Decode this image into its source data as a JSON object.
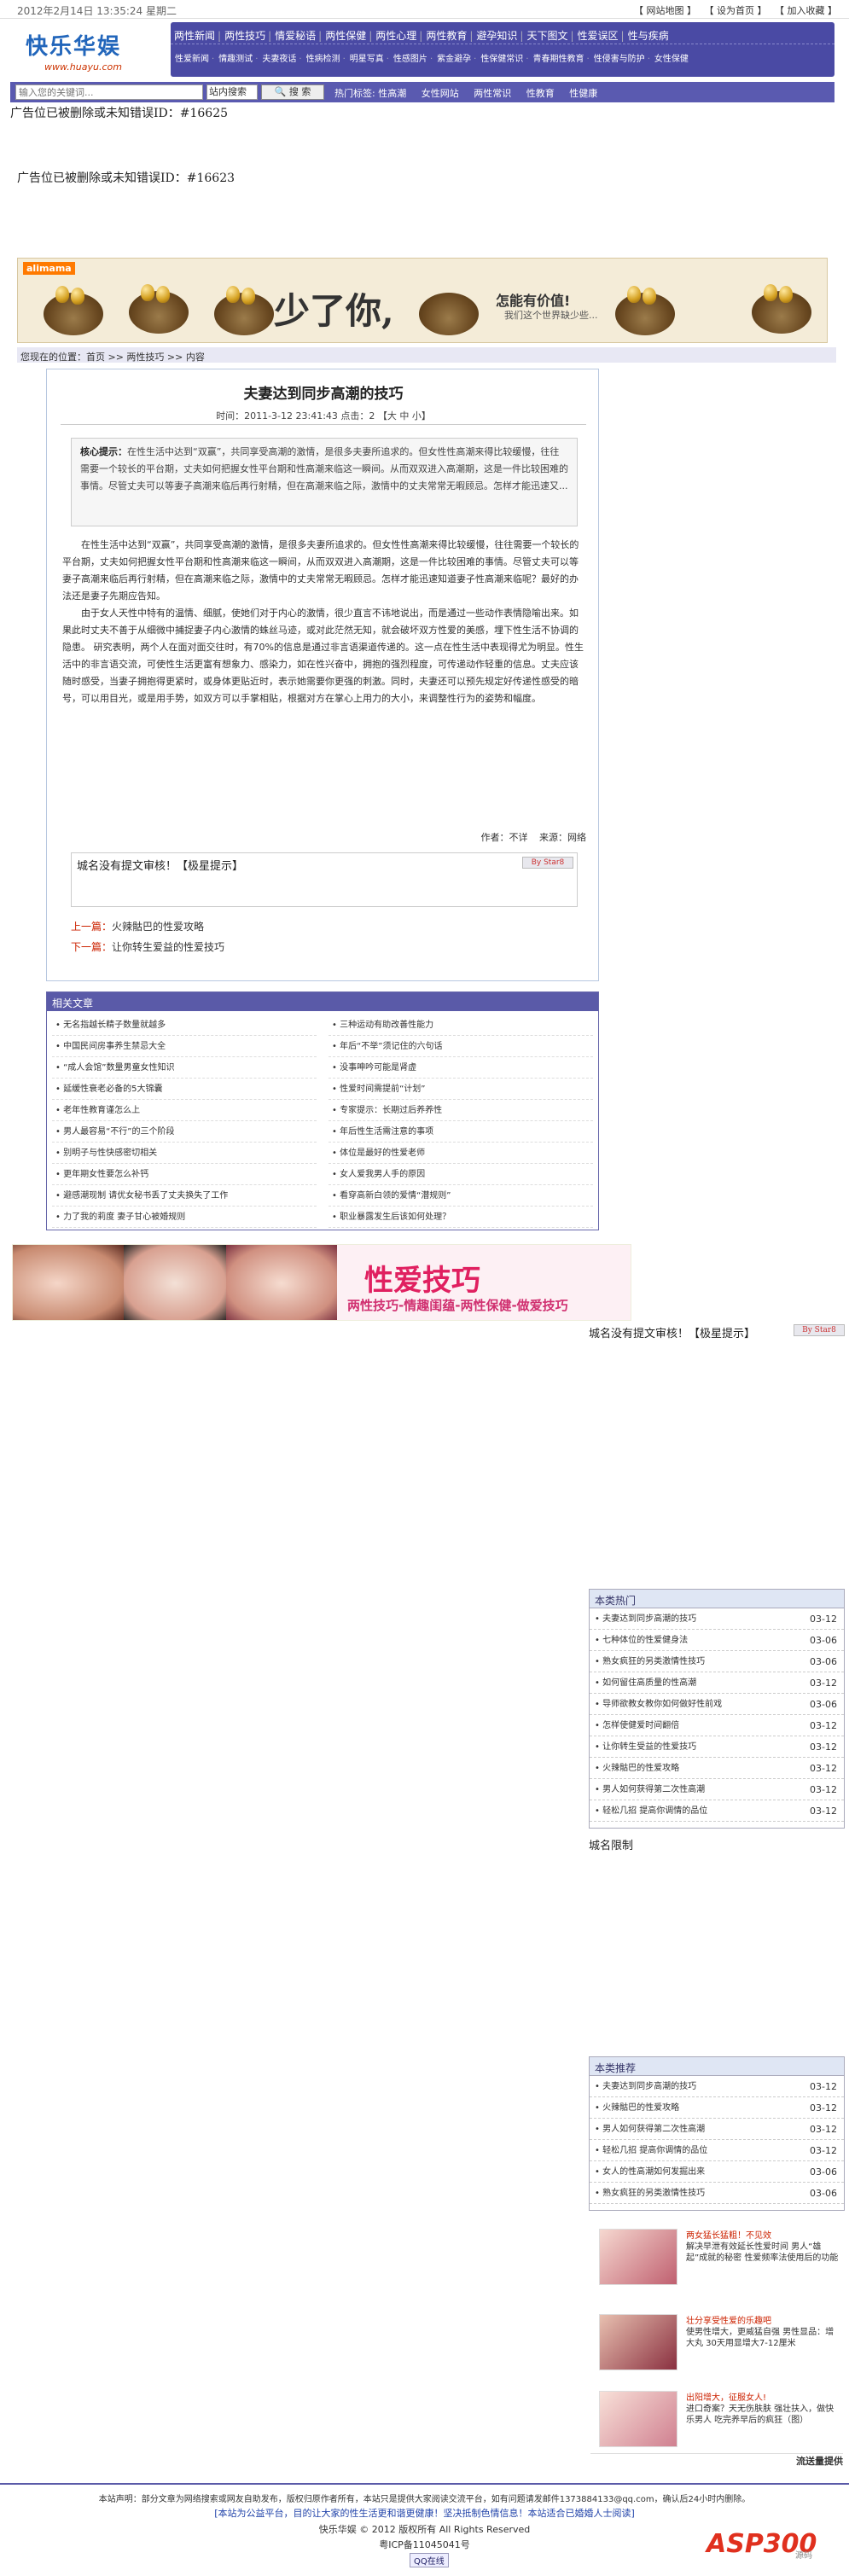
{
  "topbar": {
    "date": "2012年2月14日  13:35:24 星期二",
    "links": [
      "【 网站地图 】",
      "【 设为首页 】",
      "【 加入收藏 】"
    ]
  },
  "logo": {
    "name": "快乐华娱",
    "url_text": "www.huayu.com"
  },
  "nav": {
    "row1": [
      "两性新闻",
      "两性技巧",
      "情爱秘语",
      "两性保健",
      "两性心理",
      "两性教育",
      "避孕知识",
      "天下图文",
      "性爱误区",
      "性与疾病"
    ],
    "row2": [
      "性爱新闻",
      "情趣测试",
      "夫妻夜话",
      "性病检测",
      "明星写真",
      "性感图片",
      "紫金避孕",
      "性保健常识",
      "青春期性教育",
      "性侵害与防护",
      "女性保健"
    ]
  },
  "search": {
    "placeholder": "输入您的关键词...",
    "scope": "站内搜索",
    "button": "搜 索",
    "hot_label": "热门标签: 性高潮",
    "hot_tags": [
      "女性网站",
      "两性常识",
      "性教育",
      "性健康"
    ]
  },
  "ad_texts": [
    "广告位已被删除或未知错误ID：#16625",
    "广告位已被删除或未知错误ID：#16623"
  ],
  "banner": {
    "brand": "alimama",
    "slogan": "少了你,",
    "side": "怎能有价值!",
    "side2": "我们这个世界缺少些..."
  },
  "breadcrumb": "您现在的位置：首页 >> 两性技巧 >> 内容",
  "article": {
    "title": "夫妻达到同步高潮的技巧",
    "meta": "时间：2011-3-12 23:41:43 点击：2 【大 中 小】",
    "summary_label": "核心提示：",
    "summary": "在性生活中达到“双赢”，共同享受高潮的激情，是很多夫妻所追求的。但女性性高潮来得比较缓慢，往往需要一个较长的平台期，丈夫如何把握女性平台期和性高潮来临这一瞬间。从而双双进入高潮期，这是一件比较困难的事情。尽管丈夫可以等妻子高潮来临后再行射精，但在高潮来临之际，激情中的丈夫常常无暇顾忌。怎样才能迅速又...",
    "body_p1": "在性生活中达到“双赢”，共同享受高潮的激情，是很多夫妻所追求的。但女性性高潮来得比较缓慢，往往需要一个较长的平台期，丈夫如何把握女性平台期和性高潮来临这一瞬间，从而双双进入高潮期，这是一件比较困难的事情。尽管丈夫可以等妻子高潮来临后再行射精，但在高潮来临之际，激情中的丈夫常常无暇顾忌。怎样才能迅速知道妻子性高潮来临呢？最好的办法还是妻子先期应告知。",
    "body_p2": "由于女人天性中特有的温情、细腻，使她们对于内心的激情，很少直言不讳地说出，而是通过一些动作表情隐喻出来。如果此时丈夫不善于从细微中捕捉妻子内心激情的蛛丝马迹，或对此茫然无知，就会破坏双方性爱的美感，埋下性生活不协调的隐患。   研究表明，两个人在面对面交往时，有70%的信息是通过非言语渠道传递的。这一点在性生活中表现得尤为明显。性生活中的非言语交流，可使性生活更富有想象力、感染力，如在性兴奋中，拥抱的强烈程度，可传递动作轻重的信息。丈夫应该随时感受，当妻子拥抱得更紧时，或身体更贴近时，表示她需要你更强的刺激。同时，夫妻还可以预先规定好传递性感受的暗号，可以用目光，或是用手势，如双方可以手掌相贴，根据对方在掌心上用力的大小，来调整性行为的姿势和幅度。",
    "author": "作者：不详",
    "source": "来源：网络",
    "ad_box_text": "城名没有提文审核！【极星提示】",
    "ad_badge": "By Star8",
    "prev_label": "上一篇：",
    "prev_title": "火辣骷巴的性爱攻略",
    "next_label": "下一篇：",
    "next_title": "让你转生爱益的性爱技巧"
  },
  "related": {
    "title": "相关文章",
    "left": [
      "无名指越长精子数量就越多",
      "中国民间房事养生禁忌大全",
      "“成人会馆”数量男童女性知识",
      "延缓性衰老必备的5大锦囊",
      "老年性教育谨怎么上",
      "男人最容易“不行”的三个阶段",
      "别明子与性快感密切相关",
      "更年期女性要怎么补钙",
      "避感潮现制 请优女秘书丢了丈夫换失了工作",
      "力了我的莉度 妻子甘心被婚规则"
    ],
    "right": [
      "三种运动有助改善性能力",
      "年后“不举”须记住的六句话",
      "没事呻吟可能是肾虚",
      "性爱时间需提前“计划”",
      "专家提示：长期过后养养性",
      "年后性生活需注意的事项",
      "体位是最好的性爱老师",
      "女人爱我男人手的原因",
      "看穿高新白领的爱情“潜规则”",
      "职业暴露发生后该如何处理？"
    ]
  },
  "lingerie": {
    "title": "性爱技巧",
    "subtitle": "两性技巧-情趣闺蕴-两性保健-做爱技巧"
  },
  "side_ad": {
    "text": "城名没有提文审核！【极星提示】",
    "badge": "By Star8"
  },
  "hot": {
    "title": "本类热门",
    "items": [
      {
        "t": "夫妻达到同步高潮的技巧",
        "d": "03-12"
      },
      {
        "t": "七种体位的性爱健身法",
        "d": "03-06"
      },
      {
        "t": "熟女疯狂的另类激情性技巧",
        "d": "03-06"
      },
      {
        "t": "如何留住高质量的性高潮",
        "d": "03-12"
      },
      {
        "t": "导师欲教女教你如何做好性前戏",
        "d": "03-06"
      },
      {
        "t": "怎样使健爱时间翻倍",
        "d": "03-12"
      },
      {
        "t": "让你转生受益的性爱技巧",
        "d": "03-12"
      },
      {
        "t": "火辣骷巴的性爱攻略",
        "d": "03-12"
      },
      {
        "t": "男人如何获得第二次性高潮",
        "d": "03-12"
      },
      {
        "t": "轻松几招 提高你调情的品位",
        "d": "03-12"
      }
    ]
  },
  "domain_limit": "城名限制",
  "recommend": {
    "title": "本类推荐",
    "items": [
      {
        "t": "夫妻达到同步高潮的技巧",
        "d": "03-12"
      },
      {
        "t": "火辣骷巴的性爱攻略",
        "d": "03-12"
      },
      {
        "t": "男人如何获得第二次性高潮",
        "d": "03-12"
      },
      {
        "t": "轻松几招 提高你调情的品位",
        "d": "03-12"
      },
      {
        "t": "女人的性高潮如何发掘出来",
        "d": "03-06"
      },
      {
        "t": "熟女疯狂的另类激情性技巧",
        "d": "03-06"
      }
    ]
  },
  "promos": [
    {
      "a": "两女猛长猛粗！不见效",
      "b": "解决早泄有效延长性爱时间 男人“雄起”成就的秘密 性爱频率法使用后的功能"
    },
    {
      "a": "壮分享受性爱的乐趣吧",
      "b": "使男性增大，更威猛自强 男性显品：增大丸 30天用显增大7-12厘米"
    },
    {
      "a": "出阳增大，征服女人!",
      "b": "进口奇案？天无伤肤肤 强壮扶入，做快乐男人 吃完养早后的疯狂（图）"
    }
  ],
  "flow_text": "流送量提供",
  "footer": {
    "f1": "本站声明：部分文章为网络搜索或网友自助发布，版权归原作者所有，本站只是提供大家阅读交流平台，如有问题请发邮件1373884133@qq.com，确认后24小时内删除。",
    "f2": "[本站为公益平台，目的让大家的性生活更和谐更健康！坚决抵制色情信息！本站适合已婚婚人士阅读]",
    "f3": "快乐华娱 © 2012 版权所有 All Rights Reserved",
    "f4": "粤ICP备11045041号",
    "qq": "QQ在线"
  },
  "asp": {
    "brand": "ASP300",
    "sub": "源码"
  }
}
